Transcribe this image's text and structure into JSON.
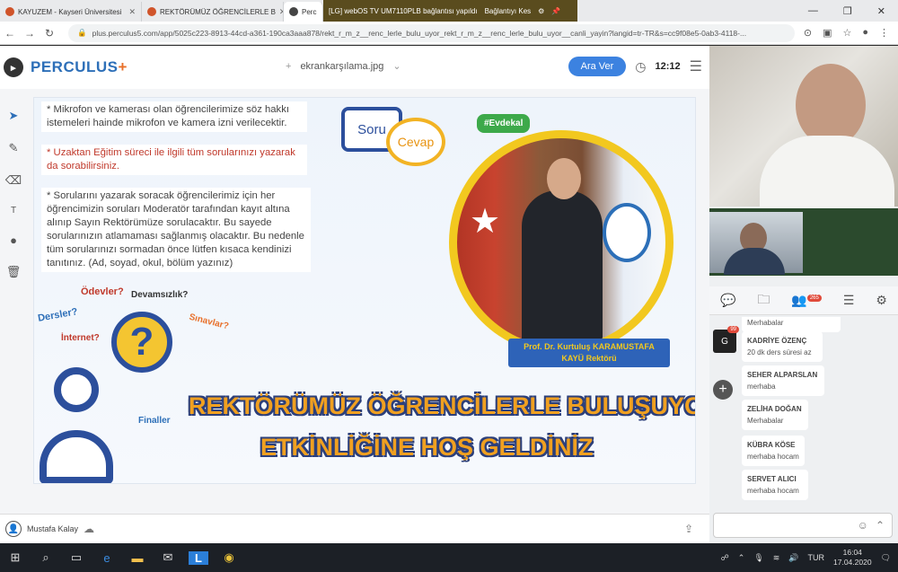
{
  "browser": {
    "tabs": [
      {
        "label": "KAYUZEM - Kayseri Üniversitesi",
        "color": "#d0542a"
      },
      {
        "label": "REKTÖRÜMÜZ ÖĞRENCİLERLE B",
        "color": "#d0542a"
      },
      {
        "label": "Perc",
        "color": "#444444"
      }
    ],
    "cast_label": "[LG] webOS TV UM7110PLB bağlantısı yapıldı",
    "disconnect_label": "Bağlantıyı Kes",
    "url": "plus.perculus5.com/app/5025c223-8913-44cd-a361-190ca3aaa878/rekt_r_m_z__renc_lerle_bulu_uyor_rekt_r_m_z__renc_lerle_bulu_uyor__canli_yayin?langid=tr-TR&s=cc9f08e5-0ab3-4118-..."
  },
  "app": {
    "brand": "PERCULUS",
    "brand_plus": "+",
    "file_name": "ekrankarşılama.jpg",
    "break_button": "Ara Ver",
    "timer": "12:12",
    "user_name": "Mustafa Kalay"
  },
  "slide": {
    "notes": [
      "* Mikrofon ve kamerası olan öğrencilerimize söz hakkı istemeleri hainde mikrofon ve kamera izni verilecektir.",
      "* Uzaktan Eğitim süreci ile ilgili tüm sorularınızı yazarak da sorabilirsiniz.",
      "* Sorularını yazarak soracak öğrencilerimiz için her öğrencimizin soruları Moderatör tarafından kayıt altına alınıp Sayın Rektörümüze sorulacaktır. Bu sayede sorularınızın atlamaması sağlanmış olacaktır. Bu nedenle tüm sorularınızı sormadan önce lütfen kısaca kendinizi tanıtınız. (Ad, soyad, okul, bölüm yazınız)"
    ],
    "soru": "Soru",
    "cevap": "Cevap",
    "words": {
      "odevler": "Ödevler?",
      "devamsizlik": "Devamsızlık?",
      "dersler": "Dersler?",
      "sinavlar": "Sınavlar?",
      "internet": "İnternet?",
      "finaller": "Finaller"
    },
    "question_mark": "?",
    "hashtag": "#Evdekal",
    "rector_name": "Prof. Dr. Kurtuluş KARAMUSTAFA",
    "rector_title": "KAYÜ Rektörü",
    "title_line1": "REKTÖRÜMÜZ ÖĞRENCİLERLE BULUŞUYOR",
    "title_line2": "ETKİNLİĞİNE HOŞ GELDİNİZ"
  },
  "panel": {
    "participant_badge": "265",
    "first_msg": "Merhabalar",
    "g_avatar": "G",
    "g_badge": "99",
    "messages": [
      {
        "name": "KADRİYE ÖZENÇ",
        "text": "20 dk ders süresi az"
      },
      {
        "name": "SEHER ALPARSLAN",
        "text": "merhaba"
      },
      {
        "name": "ZELİHA DOĞAN",
        "text": "Merhabalar"
      },
      {
        "name": "KÜBRA KÖSE",
        "text": "merhaba hocam"
      },
      {
        "name": "SERVET ALICI",
        "text": "merhaba hocam"
      }
    ]
  },
  "taskbar": {
    "lang": "TUR",
    "time": "16:04",
    "date": "17.04.2020"
  }
}
